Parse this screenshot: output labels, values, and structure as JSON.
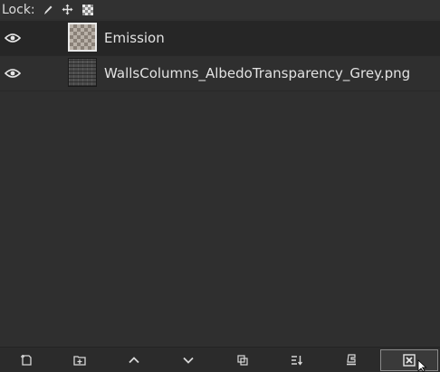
{
  "lock_bar": {
    "label": "Lock:",
    "icons": [
      "brush-icon",
      "move-icon",
      "checkerboard-icon"
    ]
  },
  "layers": [
    {
      "name": "Emission",
      "visible": true,
      "thumbnail": "checkerboard",
      "selected": true
    },
    {
      "name": "WallsColumns_AlbedoTransparency_Grey.png",
      "visible": true,
      "thumbnail": "texture",
      "selected": false
    }
  ],
  "toolbar": {
    "buttons": [
      "new-layer-icon",
      "new-layer-group-icon",
      "raise-layer-icon",
      "lower-layer-icon",
      "duplicate-layer-icon",
      "merge-down-icon",
      "anchor-layer-icon",
      "delete-layer-icon"
    ]
  },
  "colors": {
    "background": "#2f2f2f",
    "selected_row": "#262626",
    "text": "#e2e2e2"
  }
}
